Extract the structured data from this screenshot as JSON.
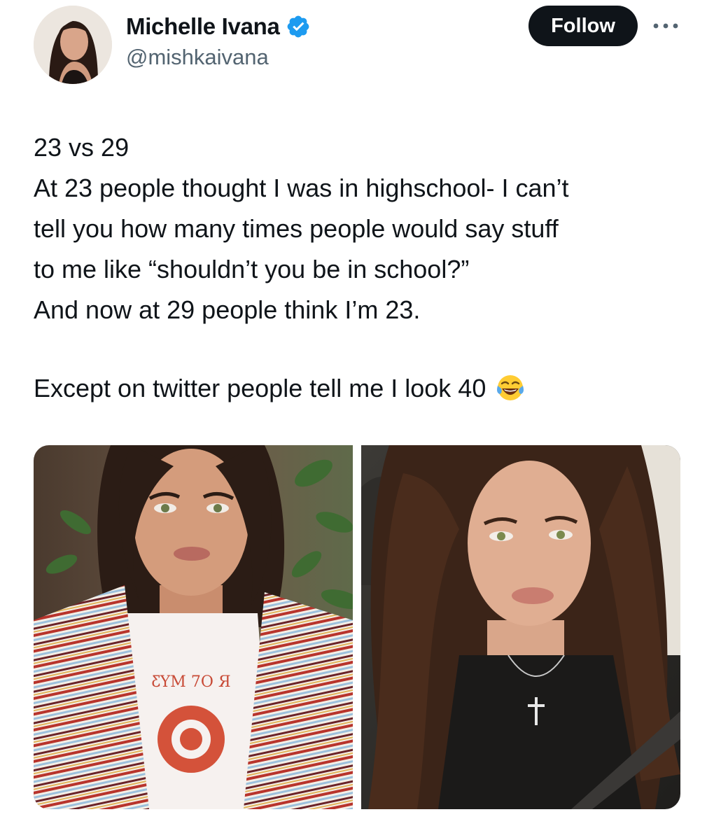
{
  "author": {
    "display_name": "Michelle Ivana",
    "handle": "@mishkaivana",
    "verified": true,
    "avatar_icon": "profile-avatar"
  },
  "actions": {
    "follow_label": "Follow",
    "more_icon": "more-horizontal-icon"
  },
  "tweet": {
    "lines": [
      "23 vs 29",
      "At 23 people thought I was in highschool- I can’t",
      "tell you how many times people would say stuff",
      "to me like “shouldn’t you be in school?”",
      "And now at 29 people think I’m 23."
    ],
    "last_line": "Except on twitter people tell me I look 40",
    "emoji": "face-with-tears-of-joy-icon"
  },
  "media": {
    "photos": [
      {
        "name": "selfie-at-23"
      },
      {
        "name": "selfie-at-29"
      }
    ],
    "shirt_print": "ƸYM 7O Я"
  },
  "colors": {
    "text": "#0f1419",
    "secondary": "#536471",
    "verified_blue": "#1d9bf0",
    "follow_bg": "#0f1419"
  }
}
